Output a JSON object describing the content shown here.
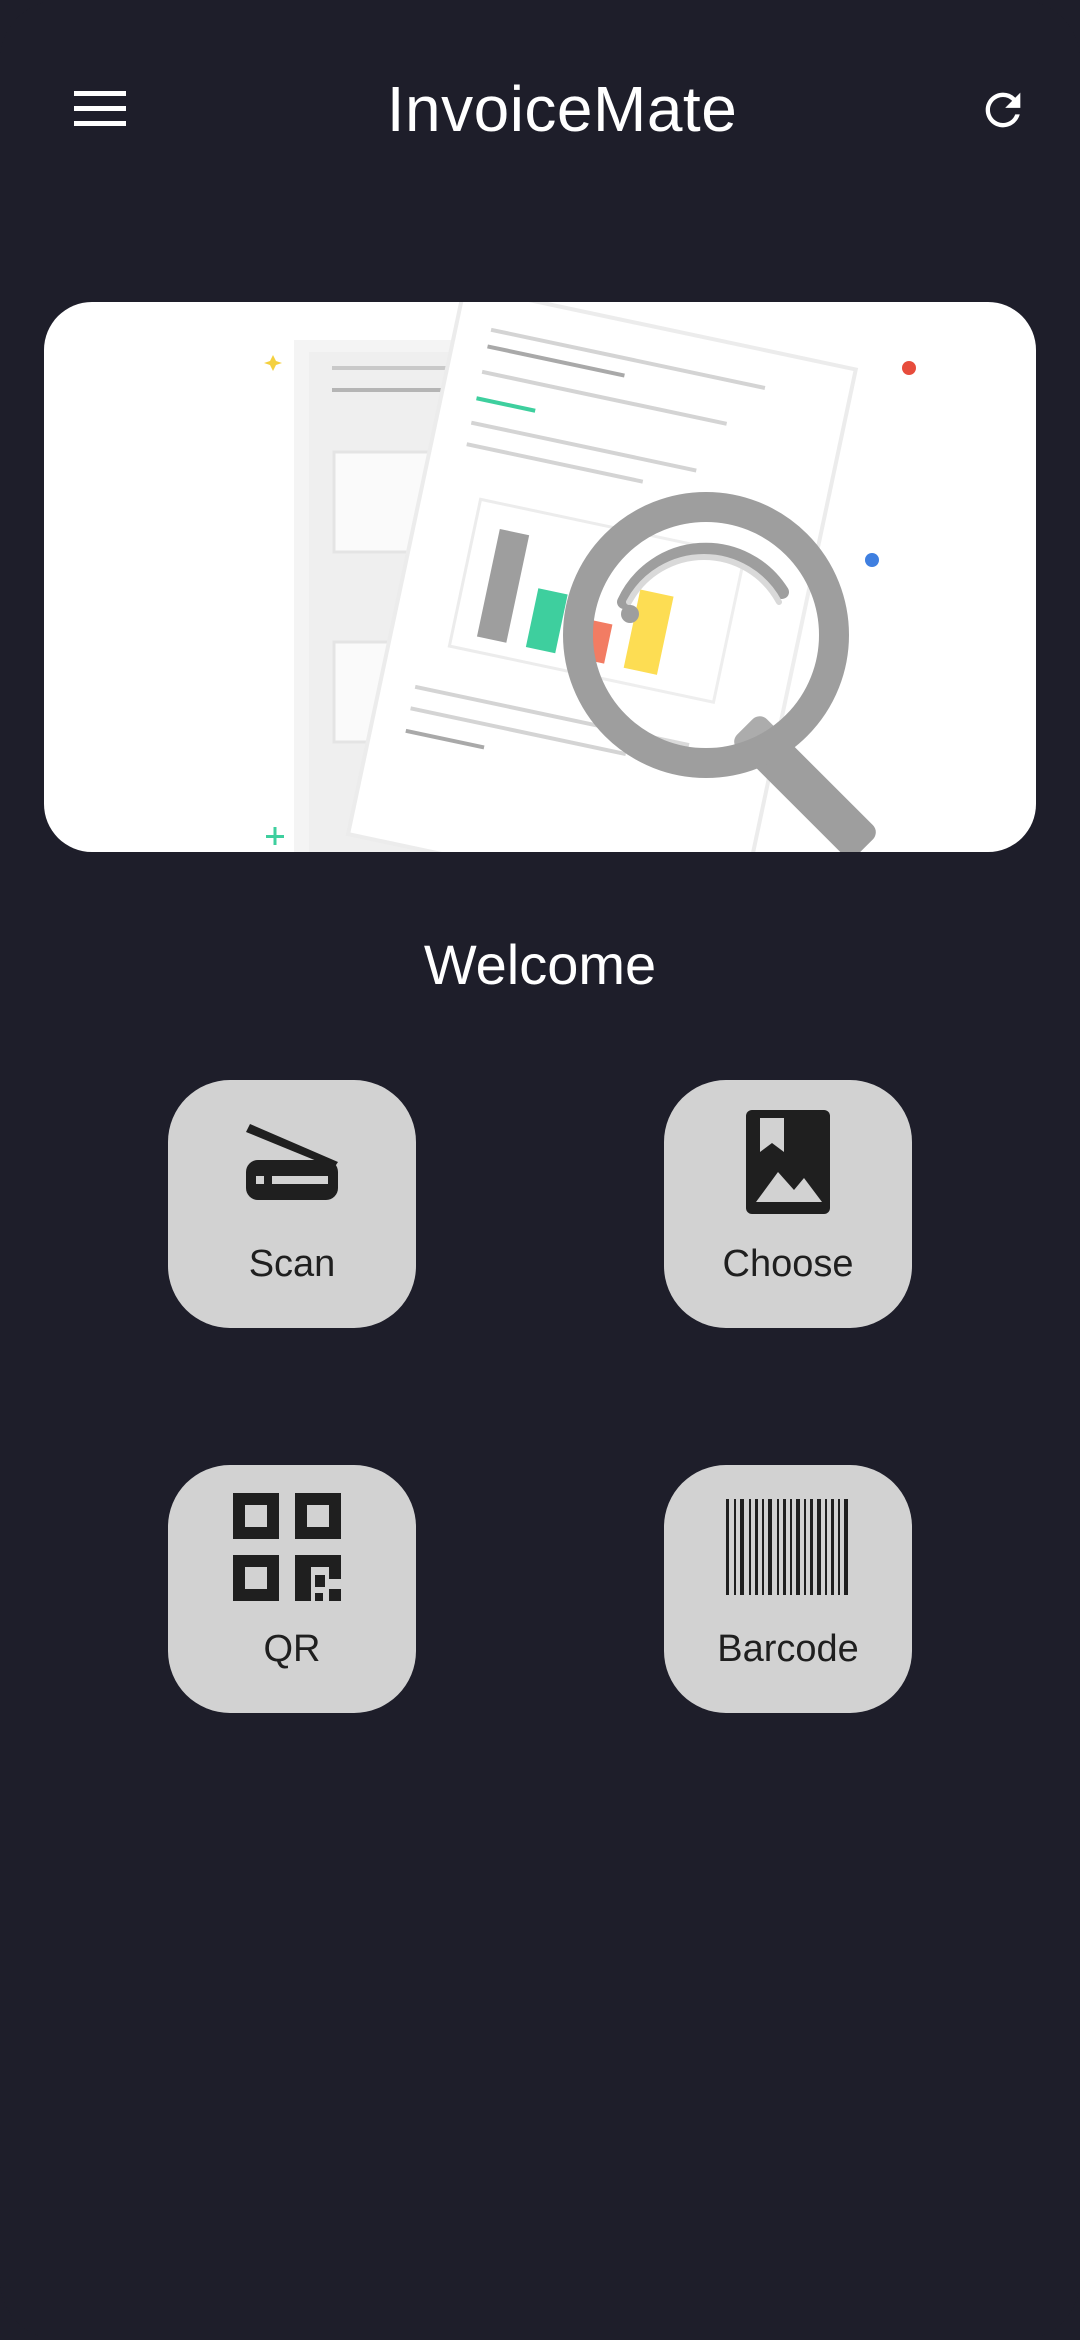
{
  "app": {
    "title": "InvoiceMate"
  },
  "header": {
    "menu_icon": "hamburger-menu-icon",
    "refresh_icon": "refresh-icon"
  },
  "hero": {
    "illustration": "documents-magnifier-illustration",
    "accent_colors": [
      "#f4d03f",
      "#e74c3c",
      "#3f7fe0",
      "#3ecf9e"
    ]
  },
  "welcome": {
    "text": "Welcome"
  },
  "actions": [
    {
      "label": "Scan",
      "icon": "scanner-icon"
    },
    {
      "label": "Choose",
      "icon": "gallery-image-icon"
    },
    {
      "label": "QR",
      "icon": "qr-code-icon"
    },
    {
      "label": "Barcode",
      "icon": "barcode-icon"
    }
  ],
  "theme": {
    "background": "#1e1e2a",
    "button_background": "#d2d2d2",
    "text_light": "#ffffff",
    "text_dark": "#1f1f1f"
  }
}
